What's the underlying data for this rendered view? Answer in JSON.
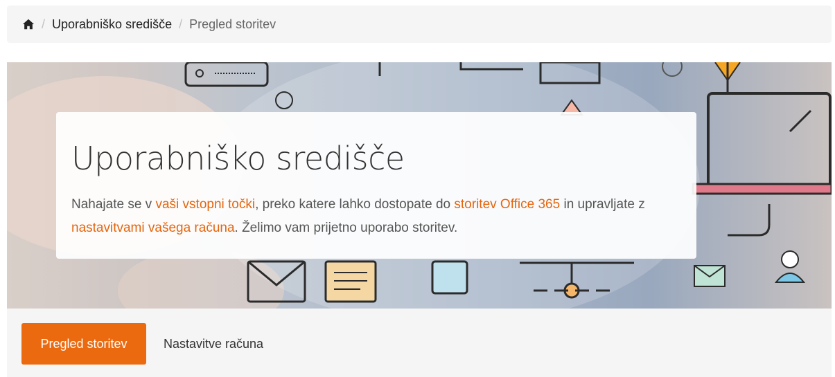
{
  "breadcrumb": {
    "home_icon": "home-icon",
    "separator": "/",
    "items": [
      "Uporabniško središče",
      "Pregled storitev"
    ]
  },
  "hero": {
    "title": "Uporabniško središče",
    "text_1": "Nahajate se v ",
    "link_1": "vaši vstopni točki",
    "text_2": ", preko katere lahko dostopate do ",
    "link_2": "storitev Office 365",
    "text_3": " in upravljate z ",
    "link_3": "nastavitvami vašega računa",
    "text_4": ". Želimo vam prijetno uporabo storitev."
  },
  "tabs": [
    {
      "label": "Pregled storitev",
      "active": true
    },
    {
      "label": "Nastavitve računa",
      "active": false
    }
  ],
  "colors": {
    "accent": "#ec6a0f",
    "link": "#e4650d"
  }
}
